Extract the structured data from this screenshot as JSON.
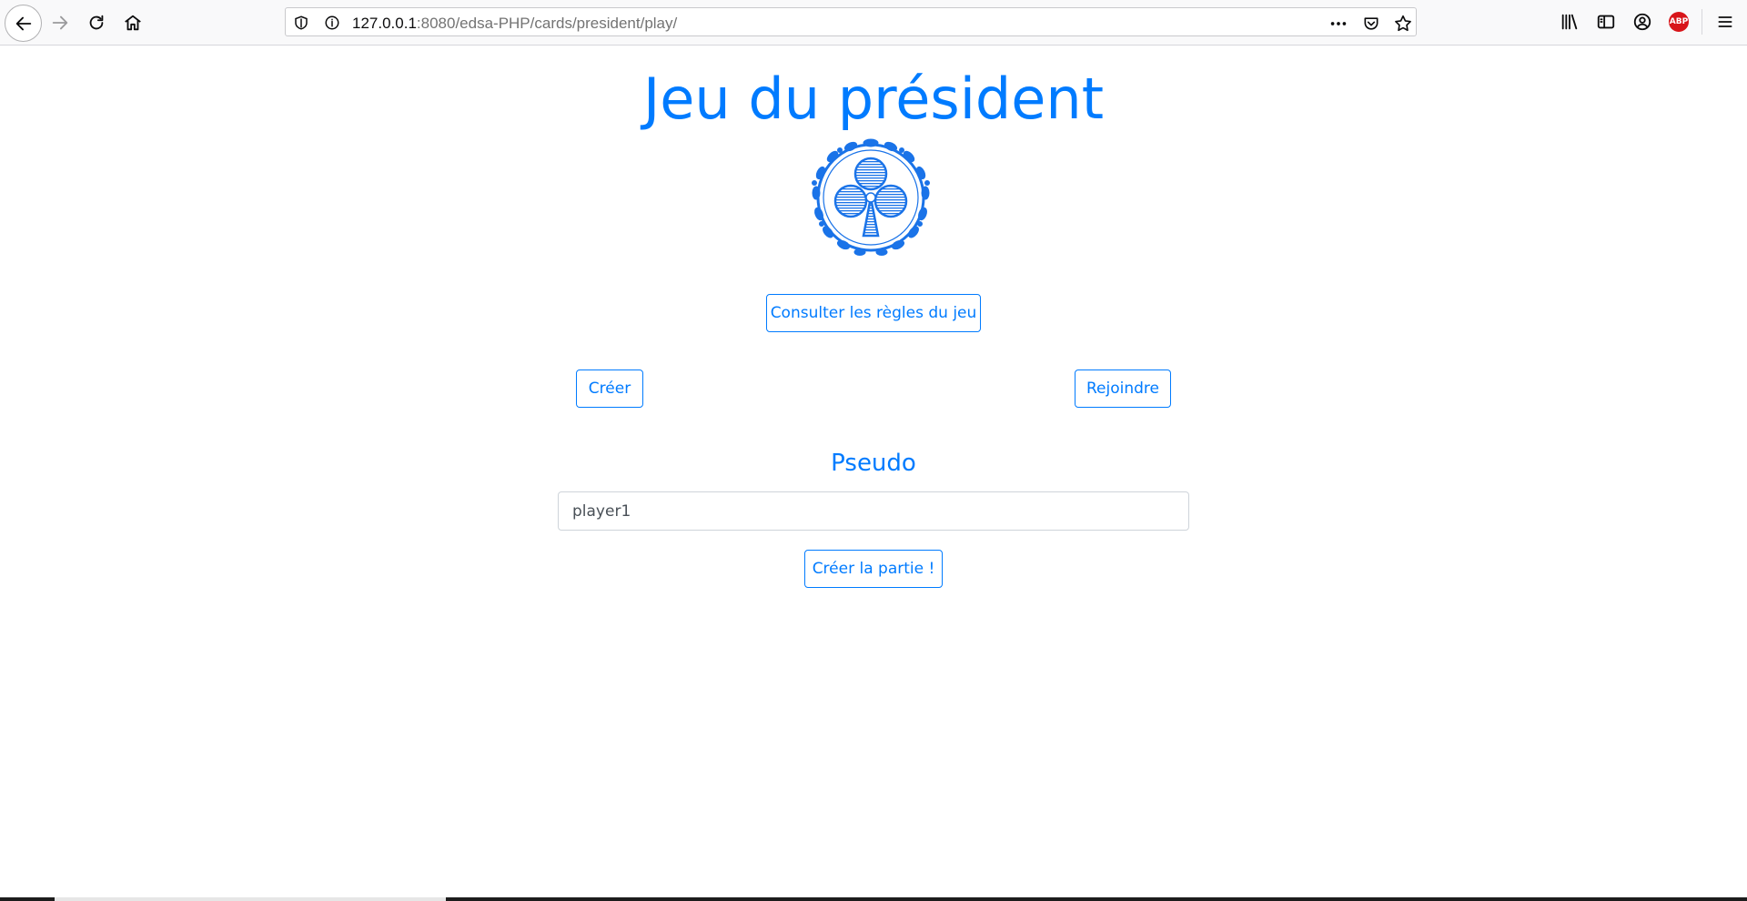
{
  "browser": {
    "url_host": "127.0.0.1",
    "url_rest": ":8080/edsa-PHP/cards/president/play/"
  },
  "page": {
    "title": "Jeu du président",
    "rules_button": "Consulter les règles du jeu",
    "create_button": "Créer",
    "join_button": "Rejoindre",
    "pseudo_label": "Pseudo",
    "pseudo_value": "player1",
    "create_game_button": "Créer la partie !"
  },
  "colors": {
    "accent": "#007bff",
    "abp_badge": "#d8151a"
  },
  "icons": [
    "back-icon",
    "forward-icon",
    "reload-icon",
    "home-icon",
    "tracking-shield-icon",
    "site-info-icon",
    "more-icon",
    "pocket-icon",
    "bookmark-star-icon",
    "library-icon",
    "sidebar-icon",
    "account-icon",
    "adblock-plus-icon",
    "menu-icon",
    "club-emblem-icon"
  ],
  "abp_badge_text": "ABP"
}
